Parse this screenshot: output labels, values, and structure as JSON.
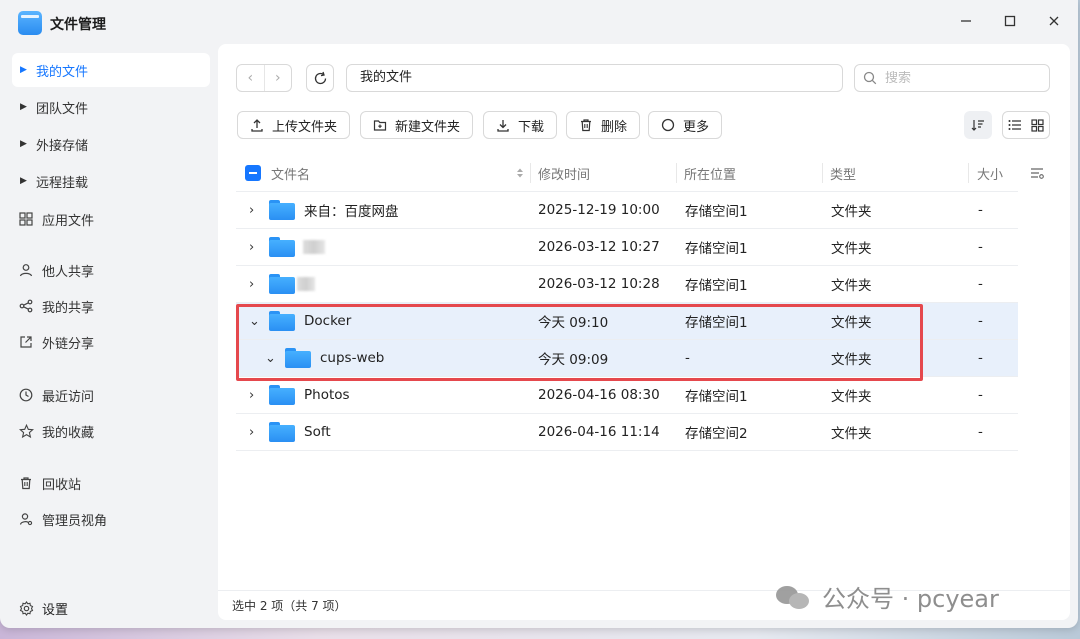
{
  "window": {
    "title": "文件管理"
  },
  "sidebar": {
    "items": [
      {
        "label": "我的文件",
        "icon": "caret-right-icon"
      },
      {
        "label": "团队文件",
        "icon": "caret-right-icon"
      },
      {
        "label": "外接存储",
        "icon": "caret-right-icon"
      },
      {
        "label": "远程挂载",
        "icon": "caret-right-icon"
      },
      {
        "label": "应用文件",
        "icon": "apps-grid-icon"
      },
      {
        "label": "他人共享",
        "icon": "person-icon"
      },
      {
        "label": "我的共享",
        "icon": "share-icon"
      },
      {
        "label": "外链分享",
        "icon": "external-link-icon"
      },
      {
        "label": "最近访问",
        "icon": "clock-icon"
      },
      {
        "label": "我的收藏",
        "icon": "star-icon"
      },
      {
        "label": "回收站",
        "icon": "trash-icon"
      },
      {
        "label": "管理员视角",
        "icon": "admin-icon"
      }
    ],
    "settings_label": "设置"
  },
  "nav": {
    "path": "我的文件",
    "search_placeholder": "搜索"
  },
  "toolbar": {
    "upload": "上传文件夹",
    "new_folder": "新建文件夹",
    "download": "下载",
    "delete": "删除",
    "more": "更多"
  },
  "table": {
    "headers": {
      "name": "文件名",
      "modified": "修改时间",
      "location": "所在位置",
      "type": "类型",
      "size": "大小"
    },
    "rows": [
      {
        "expander": "›",
        "name": "来自：百度网盘",
        "modified": "2025-12-19 10:00",
        "location": "存储空间1",
        "type": "文件夹",
        "size": "-"
      },
      {
        "expander": "›",
        "name": "",
        "modified": "2026-03-12 10:27",
        "location": "存储空间1",
        "type": "文件夹",
        "size": "-"
      },
      {
        "expander": "›",
        "name": "",
        "modified": "2026-03-12 10:28",
        "location": "存储空间1",
        "type": "文件夹",
        "size": "-"
      },
      {
        "expander": "⌄",
        "name": "Docker",
        "modified": "今天 09:10",
        "location": "存储空间1",
        "type": "文件夹",
        "size": "-"
      },
      {
        "expander": "⌄",
        "name": "cups-web",
        "modified": "今天 09:09",
        "location": "-",
        "type": "文件夹",
        "size": "-"
      },
      {
        "expander": "›",
        "name": "Photos",
        "modified": "2026-04-16 08:30",
        "location": "存储空间1",
        "type": "文件夹",
        "size": "-"
      },
      {
        "expander": "›",
        "name": "Soft",
        "modified": "2026-04-16 11:14",
        "location": "存储空间2",
        "type": "文件夹",
        "size": "-"
      }
    ]
  },
  "status": {
    "text": "选中 2 项（共 7 项）"
  },
  "watermark": {
    "text": "公众号 · pcyear"
  },
  "colors": {
    "accent": "#1677ff",
    "highlight_border": "#e5484d",
    "selected_row": "#e8f0fb"
  }
}
